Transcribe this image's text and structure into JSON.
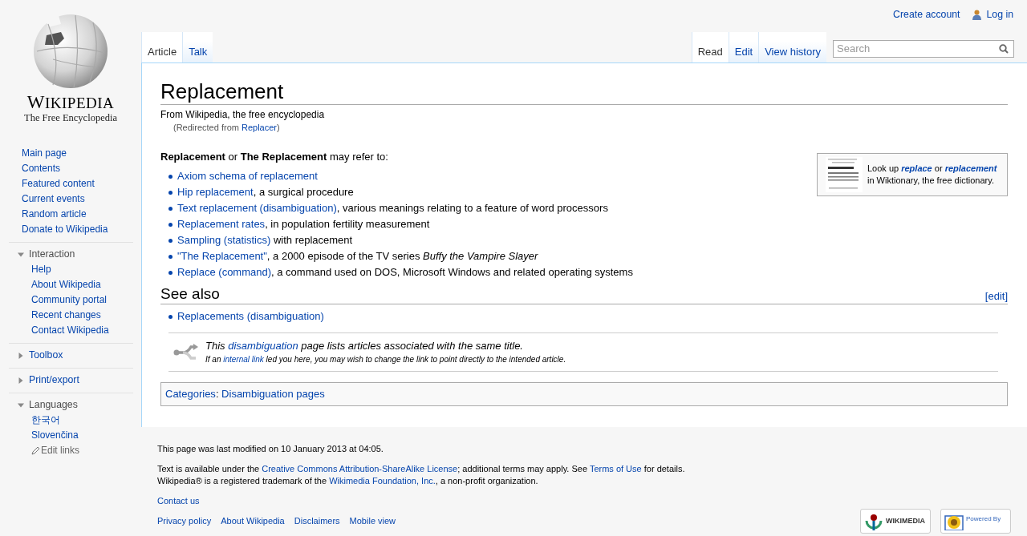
{
  "personal": {
    "create_account": "Create account",
    "log_in": "Log in"
  },
  "logo": {
    "wordmark": "WIKIPEDIA",
    "tagline": "The Free Encyclopedia"
  },
  "navigation": [
    "Main page",
    "Contents",
    "Featured content",
    "Current events",
    "Random article",
    "Donate to Wikipedia"
  ],
  "portals": [
    {
      "heading": "Interaction",
      "expanded": true,
      "items": [
        "Help",
        "About Wikipedia",
        "Community portal",
        "Recent changes",
        "Contact Wikipedia"
      ]
    },
    {
      "heading": "Toolbox",
      "expanded": false
    },
    {
      "heading": "Print/export",
      "expanded": false
    },
    {
      "heading": "Languages",
      "expanded": true,
      "items": [
        "한국어",
        "Slovenčina"
      ],
      "edit_links": "Edit links"
    }
  ],
  "tabs_left": [
    {
      "label": "Article",
      "selected": true
    },
    {
      "label": "Talk",
      "selected": false
    }
  ],
  "tabs_right": [
    {
      "label": "Read",
      "selected": true
    },
    {
      "label": "Edit",
      "selected": false
    },
    {
      "label": "View history",
      "selected": false
    }
  ],
  "search": {
    "placeholder": "Search"
  },
  "article": {
    "title": "Replacement",
    "tagline": "From Wikipedia, the free encyclopedia",
    "redirect": [
      {
        "t": "(Redirected from ",
        "kind": "text"
      },
      {
        "t": "Replacer",
        "kind": "link"
      },
      {
        "t": ")",
        "kind": "text"
      }
    ],
    "wiktionary": [
      {
        "t": "Look up ",
        "kind": "text"
      },
      {
        "t": "replace",
        "kind": "link"
      },
      {
        "t": " or ",
        "kind": "text"
      },
      {
        "t": "replacement",
        "kind": "link"
      },
      {
        "t": " in Wiktionary, the free dictionary.",
        "kind": "text"
      }
    ],
    "intro": [
      {
        "t": "Replacement",
        "kind": "bold"
      },
      {
        "t": " or ",
        "kind": "text"
      },
      {
        "t": "The Replacement",
        "kind": "bold"
      },
      {
        "t": " may refer to:",
        "kind": "text"
      }
    ],
    "items": [
      [
        {
          "t": "Axiom schema of replacement",
          "kind": "link"
        }
      ],
      [
        {
          "t": "Hip replacement",
          "kind": "link"
        },
        {
          "t": ", a surgical procedure",
          "kind": "text"
        }
      ],
      [
        {
          "t": "Text replacement (disambiguation)",
          "kind": "link"
        },
        {
          "t": ", various meanings relating to a feature of word processors",
          "kind": "text"
        }
      ],
      [
        {
          "t": "Replacement rates",
          "kind": "link"
        },
        {
          "t": ", in population fertility measurement",
          "kind": "text"
        }
      ],
      [
        {
          "t": "Sampling (statistics)",
          "kind": "link"
        },
        {
          "t": " with replacement",
          "kind": "text"
        }
      ],
      [
        {
          "t": "\"The Replacement\"",
          "kind": "link"
        },
        {
          "t": ", a 2000 episode of the TV series ",
          "kind": "text"
        },
        {
          "t": "Buffy the Vampire Slayer",
          "kind": "italic"
        }
      ],
      [
        {
          "t": "Replace (command)",
          "kind": "link"
        },
        {
          "t": ", a command used on DOS, Microsoft Windows and related operating systems",
          "kind": "text"
        }
      ]
    ],
    "see_also": {
      "heading": "See also",
      "edit": "[edit]",
      "items": [
        [
          {
            "t": "Replacements (disambiguation)",
            "kind": "link"
          }
        ]
      ]
    },
    "dab_notice": {
      "line1": [
        {
          "t": "This ",
          "kind": "text"
        },
        {
          "t": "disambiguation",
          "kind": "link"
        },
        {
          "t": " page lists articles associated with the same title.",
          "kind": "text"
        }
      ],
      "line2": [
        {
          "t": "If an ",
          "kind": "text"
        },
        {
          "t": "internal link",
          "kind": "link"
        },
        {
          "t": " led you here, you may wish to change the link to point directly to the intended article.",
          "kind": "text"
        }
      ]
    },
    "categories": [
      {
        "t": "Categories",
        "kind": "link"
      },
      {
        "t": ":  ",
        "kind": "text"
      },
      {
        "t": "Disambiguation pages",
        "kind": "link"
      }
    ]
  },
  "footer": {
    "last_modified": "This page was last modified on 10 January 2013 at 04:05.",
    "license": [
      {
        "t": "Text is available under the ",
        "kind": "text"
      },
      {
        "t": "Creative Commons Attribution-ShareAlike License",
        "kind": "link"
      },
      {
        "t": "; additional terms may apply. See ",
        "kind": "text"
      },
      {
        "t": "Terms of Use",
        "kind": "link"
      },
      {
        "t": " for details.",
        "kind": "text"
      }
    ],
    "trademark": [
      {
        "t": "Wikipedia® is a registered trademark of the ",
        "kind": "text"
      },
      {
        "t": "Wikimedia Foundation, Inc.",
        "kind": "link"
      },
      {
        "t": ", a non-profit organization.",
        "kind": "text"
      }
    ],
    "contact": "Contact us",
    "links": [
      "Privacy policy",
      "About Wikipedia",
      "Disclaimers",
      "Mobile view"
    ],
    "badges": [
      "WIKIMEDIA",
      "Powered By"
    ]
  }
}
